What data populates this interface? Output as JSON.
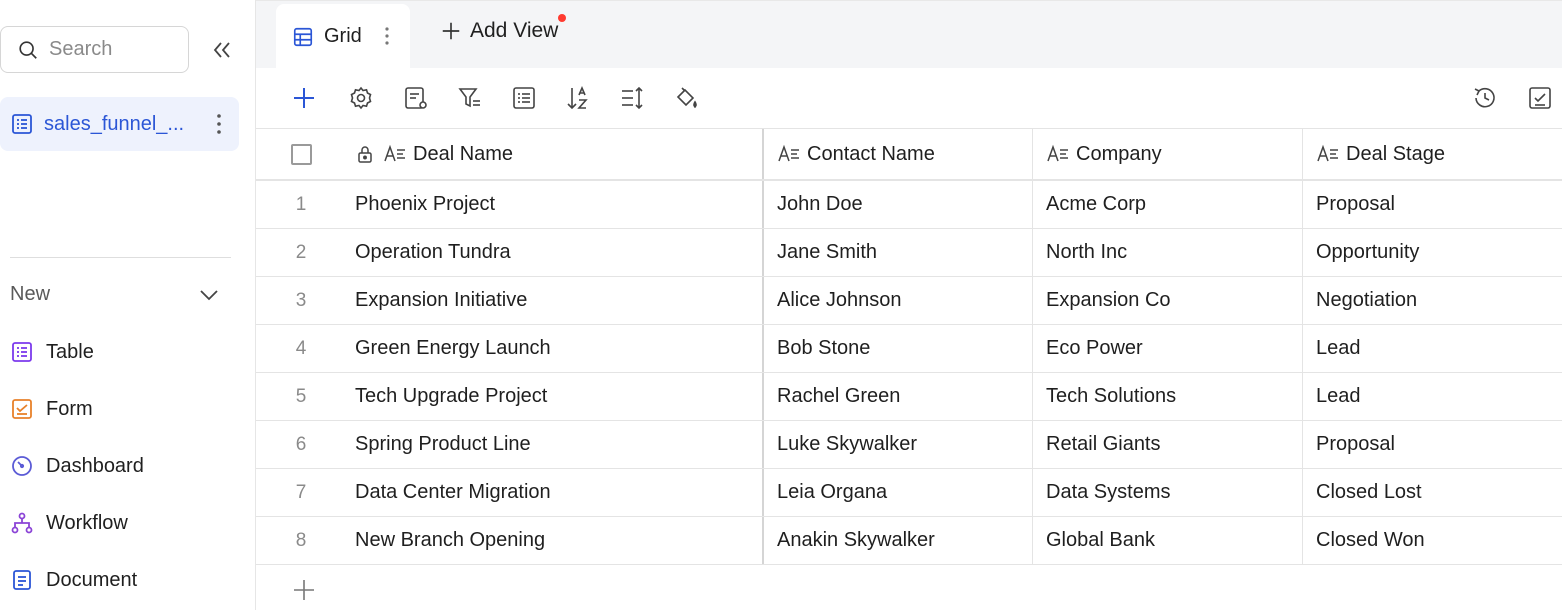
{
  "colors": {
    "accent": "#2b56d6",
    "active_bg": "#eef2fd",
    "red_dot": "#ff3b30",
    "table_icon": "#7c3aed",
    "form_icon": "#e8812a"
  },
  "sidebar": {
    "search_placeholder": "Search",
    "base_name": "sales_funnel_...",
    "new_label": "New",
    "items": [
      {
        "label": "Table",
        "icon": "table-icon"
      },
      {
        "label": "Form",
        "icon": "form-icon"
      },
      {
        "label": "Dashboard",
        "icon": "dashboard-icon"
      },
      {
        "label": "Workflow",
        "icon": "workflow-icon"
      },
      {
        "label": "Document",
        "icon": "document-icon"
      }
    ]
  },
  "tabs": {
    "active": "Grid",
    "add_view": "Add View"
  },
  "table": {
    "columns": [
      "Deal Name",
      "Contact Name",
      "Company",
      "Deal Stage"
    ],
    "rows": [
      {
        "index": "1",
        "deal": "Phoenix Project",
        "contact": "John Doe",
        "company": "Acme Corp",
        "stage": "Proposal"
      },
      {
        "index": "2",
        "deal": "Operation Tundra",
        "contact": "Jane Smith",
        "company": "North Inc",
        "stage": "Opportunity"
      },
      {
        "index": "3",
        "deal": "Expansion Initiative",
        "contact": "Alice Johnson",
        "company": "Expansion Co",
        "stage": "Negotiation"
      },
      {
        "index": "4",
        "deal": "Green Energy Launch",
        "contact": "Bob Stone",
        "company": "Eco Power",
        "stage": "Lead"
      },
      {
        "index": "5",
        "deal": "Tech Upgrade Project",
        "contact": "Rachel Green",
        "company": "Tech Solutions",
        "stage": "Lead"
      },
      {
        "index": "6",
        "deal": "Spring Product Line",
        "contact": "Luke Skywalker",
        "company": "Retail Giants",
        "stage": "Proposal"
      },
      {
        "index": "7",
        "deal": "Data Center Migration",
        "contact": "Leia Organa",
        "company": "Data Systems",
        "stage": "Closed Lost"
      },
      {
        "index": "8",
        "deal": "New Branch Opening",
        "contact": "Anakin Skywalker",
        "company": "Global Bank",
        "stage": "Closed Won"
      }
    ]
  }
}
